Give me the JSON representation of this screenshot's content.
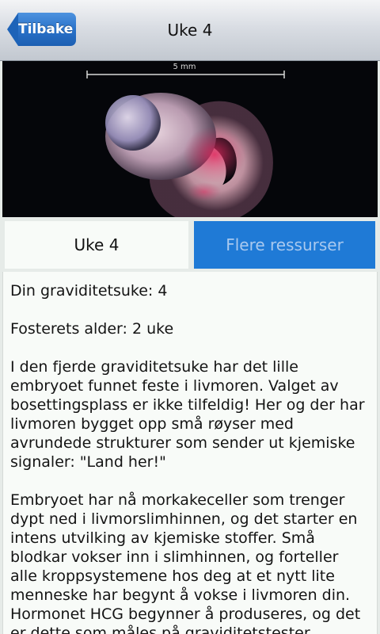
{
  "navbar": {
    "back_label": "Tilbake",
    "title": "Uke 4"
  },
  "hero_image": {
    "scale_label": "5 mm"
  },
  "tabs": {
    "week_label": "Uke 4",
    "resources_label": "Flere ressurser"
  },
  "content": {
    "pregnancy_week": "Din graviditetsuke: 4",
    "fetus_age": "Fosterets alder: 2 uke",
    "paragraph1": "I den fjerde graviditetsuke har det lille embryoet funnet feste i livmoren. Valget av bosettingsplass er ikke tilfeldig! Her og der har livmoren bygget opp små røyser med avrundede strukturer som sender ut kjemiske signaler: \"Land her!\"",
    "paragraph2": "Embryoet har nå morkakeceller som trenger dypt ned i livmorslimhinnen, og det starter en intens utvilking av kjemiske stoffer. Små blodkar vokser inn i slimhinnen, og forteller alle kroppsystemene hos deg at et nytt lite menneske har begynt å vokse i livmoren din. Hormonet HCG begynner å produseres, og det er dette som måles på graviditetstester."
  },
  "colors": {
    "accent_blue": "#1f7ad6",
    "back_button_blue": "#2a72c9"
  }
}
